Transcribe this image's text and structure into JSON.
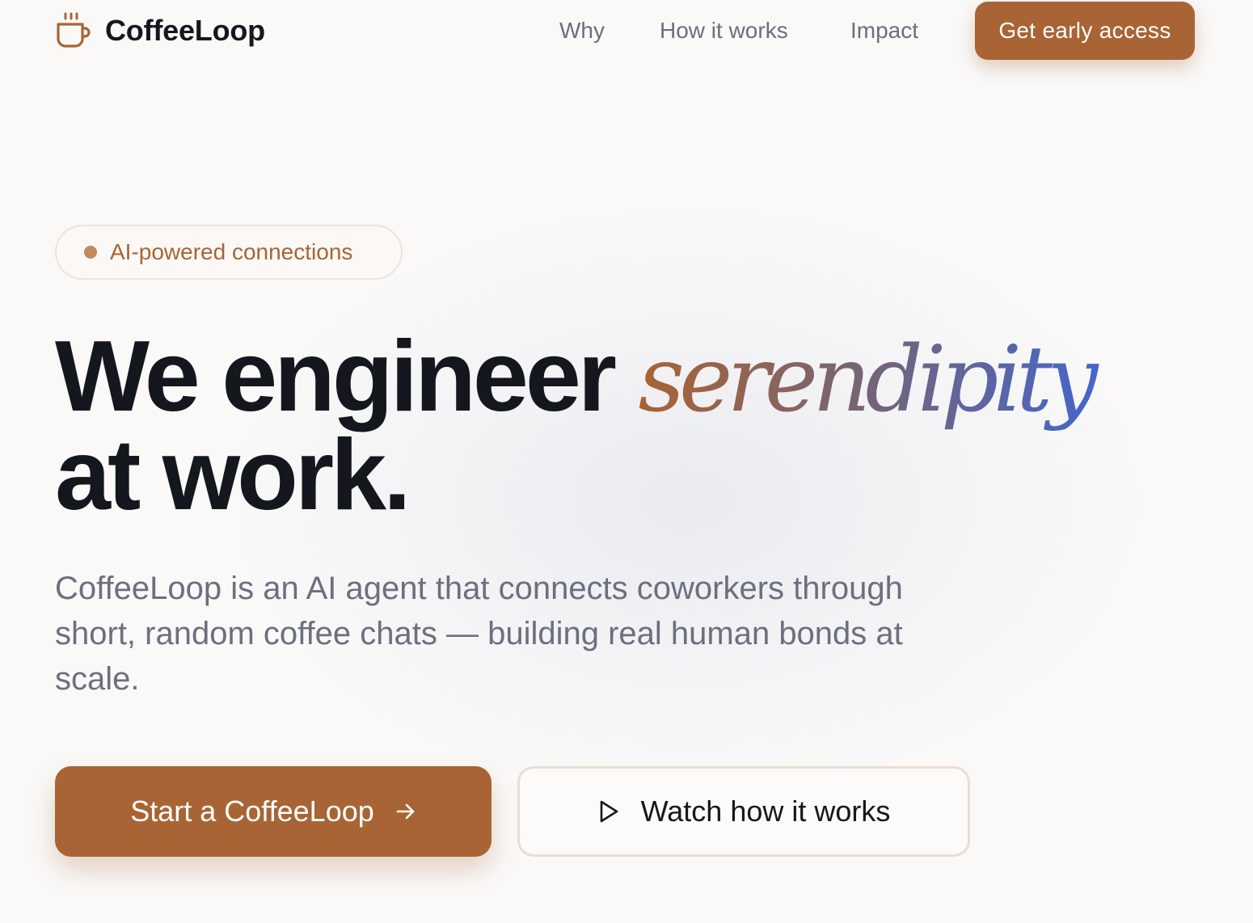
{
  "brand": {
    "name": "CoffeeLoop",
    "icon": "coffee-cup-icon",
    "accent_color": "#a86434"
  },
  "nav": {
    "links": [
      "Why",
      "How it works",
      "Impact"
    ],
    "cta_label": "Get early access"
  },
  "hero": {
    "badge": "AI-powered connections",
    "headline_part1": "We engineer",
    "headline_accent": "serendipity",
    "headline_part2": "at work.",
    "description": "CoffeeLoop is an AI agent that connects coworkers through short, random coffee chats — building real human bonds at scale.",
    "primary_cta": {
      "label": "Start a CoffeeLoop",
      "icon": "arrow-right-icon"
    },
    "secondary_cta": {
      "label": "Watch how it works",
      "icon": "play-icon"
    }
  }
}
